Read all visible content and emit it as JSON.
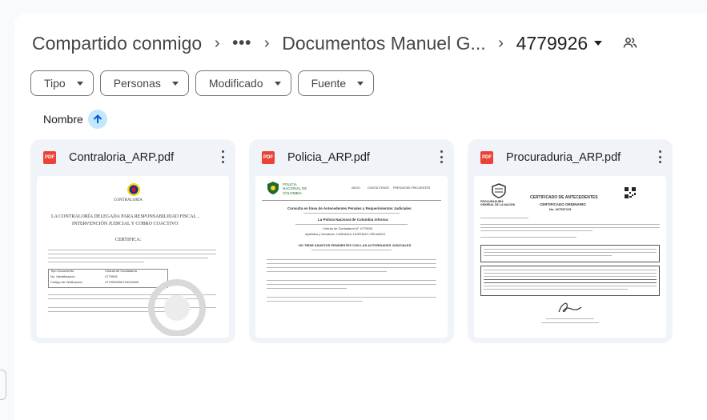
{
  "breadcrumb": {
    "root": "Compartido conmigo",
    "ellipsis": "•••",
    "folder": "Documentos Manuel G...",
    "current": "4779926"
  },
  "filters": [
    {
      "label": "Tipo"
    },
    {
      "label": "Personas"
    },
    {
      "label": "Modificado"
    },
    {
      "label": "Fuente"
    }
  ],
  "sort": {
    "label": "Nombre",
    "direction": "ascending"
  },
  "icons": {
    "breadcrumb_separator": "›",
    "share": "people-icon",
    "file_type": "pdf-icon",
    "file_type_label": "PDF",
    "more": "more-vert-icon",
    "sort": "arrow-up-icon"
  },
  "colors": {
    "pdf_red": "#ea4335",
    "sort_active": "#c2e7ff",
    "card_bg": "#f0f4f9"
  },
  "files": [
    {
      "name": "Contraloria_ARP.pdf",
      "preview": {
        "org": "CONTRALORÍA",
        "heading1": "LA CONTRALORÍA DELEGADA PARA RESPONSABILIDAD FISCAL ,",
        "heading2": "INTERVENCIÓN JUDICIAL Y COBRO COACTIVO",
        "subheading": "CERTIFICA:",
        "table": [
          [
            "Tipo Documento",
            "Cédula de Ciudadanía"
          ],
          [
            "No. Identificación",
            "4779926"
          ],
          [
            "Código de Verificación",
            "4779926250718103000"
          ]
        ]
      }
    },
    {
      "name": "Policia_ARP.pdf",
      "preview": {
        "org": "POLICÍA NACIONAL DE COLOMBIA",
        "nav": [
          "INICIO",
          "CONTÁCTENOS",
          "PREGUNTAS FRECUENTES"
        ],
        "heading": "Consulta en línea de Antecedentes Penales y Requerimientos Judiciales",
        "subheading": "La Policía Nacional de Colombia informa:",
        "id_line": "Cédula de Ciudadanía N° 4779926",
        "name_line": "Apellidos y Nombres: CARADALI HURTADO ORLANDO",
        "status": "NO TIENE ASUNTOS PENDIENTES CON LAS AUTORIDADES JUDICIALES"
      }
    },
    {
      "name": "Procuraduria_ARP.pdf",
      "preview": {
        "org": "PROCURADURÍA GENERAL DE LA NACIÓN",
        "title1": "CERTIFICADO DE ANTECEDENTES",
        "title2": "CERTIFICADO ORDINARIO",
        "number": "No. 267557115"
      }
    }
  ]
}
